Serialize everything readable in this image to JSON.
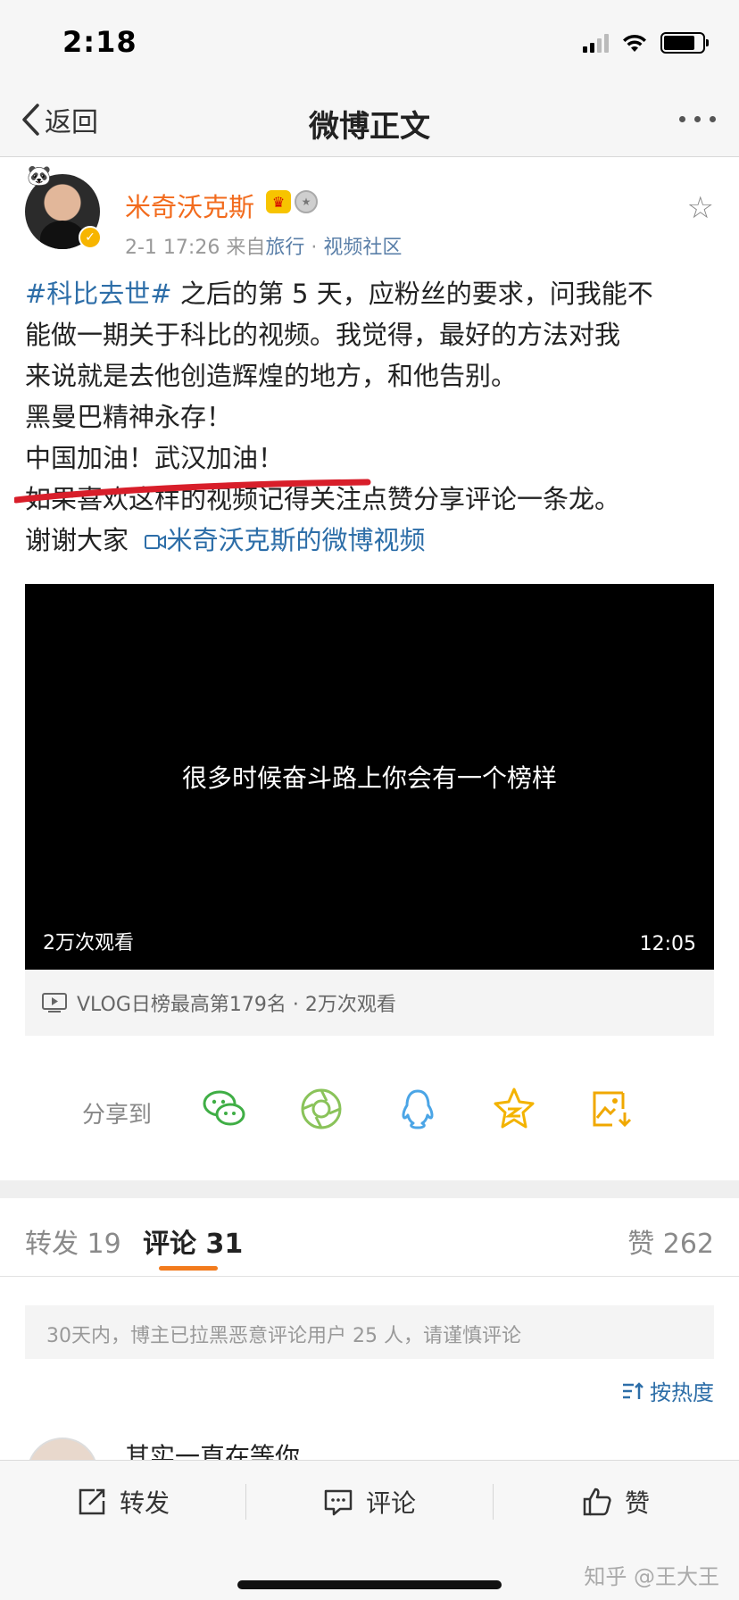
{
  "status_bar": {
    "time": "2:18"
  },
  "nav": {
    "back_label": "返回",
    "title": "微博正文"
  },
  "author": {
    "name": "米奇沃克斯",
    "time": "2-1 17:26",
    "from_prefix": "来自",
    "source": "旅行",
    "separator": "·",
    "community": "视频社区"
  },
  "post": {
    "topic": "#科比去世#",
    "line1_rest": " 之后的第 5 天，应粉丝的要求，问我能不",
    "line2": "能做一期关于科比的视频。我觉得，最好的方法对我",
    "line3": "来说就是去他创造辉煌的地方，和他告别。",
    "line4": "黑曼巴精神永存！",
    "line5": "中国加油！武汉加油！",
    "line6": "如果喜欢这样的视频记得关注点赞分享评论一条龙。",
    "line7_text": "谢谢大家",
    "video_link": "米奇沃克斯的微博视频"
  },
  "video": {
    "caption": "很多时候奋斗路上你会有一个榜样",
    "views": "2万次观看",
    "duration": "12:05",
    "vlog_info": "VLOG日榜最高第179名 · 2万次观看"
  },
  "share": {
    "label": "分享到",
    "targets": [
      "wechat-icon",
      "moments-icon",
      "qq-icon",
      "qzone-icon",
      "save-image-icon"
    ]
  },
  "tabs": {
    "repost": "转发 19",
    "comment": "评论 31",
    "like": "赞 262"
  },
  "notice": "30天内，博主已拉黑恶意评论用户 25 人，请谨慎评论",
  "sort_label": "按热度",
  "first_comment": "其实一直在等你",
  "bottom": {
    "repost": "转发",
    "comment": "评论",
    "like": "赞"
  },
  "watermark": "知乎 @王大王",
  "colors": {
    "accent_orange": "#f27b1d",
    "link_blue": "#2d6ea8",
    "username_orange": "#f26b1d"
  }
}
